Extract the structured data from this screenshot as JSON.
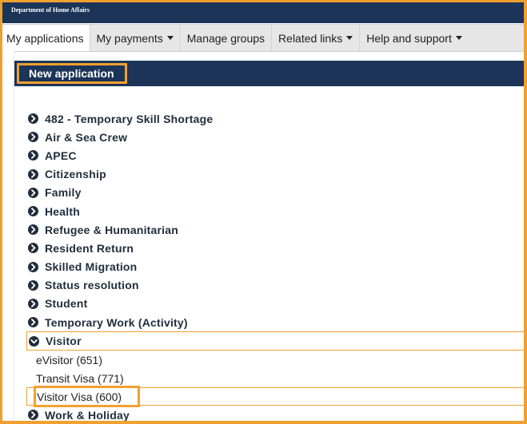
{
  "header": {
    "agency": "Department of Home Affairs"
  },
  "nav": [
    {
      "label": "My applications",
      "dropdown": false,
      "active": true
    },
    {
      "label": "My payments",
      "dropdown": true
    },
    {
      "label": "Manage groups",
      "dropdown": false
    },
    {
      "label": "Related links",
      "dropdown": true
    },
    {
      "label": "Help and support",
      "dropdown": true
    }
  ],
  "main": {
    "new_application_label": "New application",
    "categories": [
      "482 - Temporary Skill Shortage",
      "Air & Sea Crew",
      "APEC",
      "Citizenship",
      "Family",
      "Health",
      "Refugee & Humanitarian",
      "Resident Return",
      "Skilled Migration",
      "Status resolution",
      "Student",
      "Temporary Work (Activity)",
      "Visitor"
    ],
    "visitor_options": [
      "eVisitor (651)",
      "Transit Visa (771)",
      "Visitor Visa (600)"
    ],
    "after_categories": [
      "Work & Holiday"
    ]
  },
  "colors": {
    "navy": "#1b3458",
    "highlight": "#f0a030",
    "icon": "#1f2d3d"
  },
  "icons": {
    "collapsed": "chevron-right-circle-icon",
    "expanded": "chevron-down-circle-icon"
  }
}
